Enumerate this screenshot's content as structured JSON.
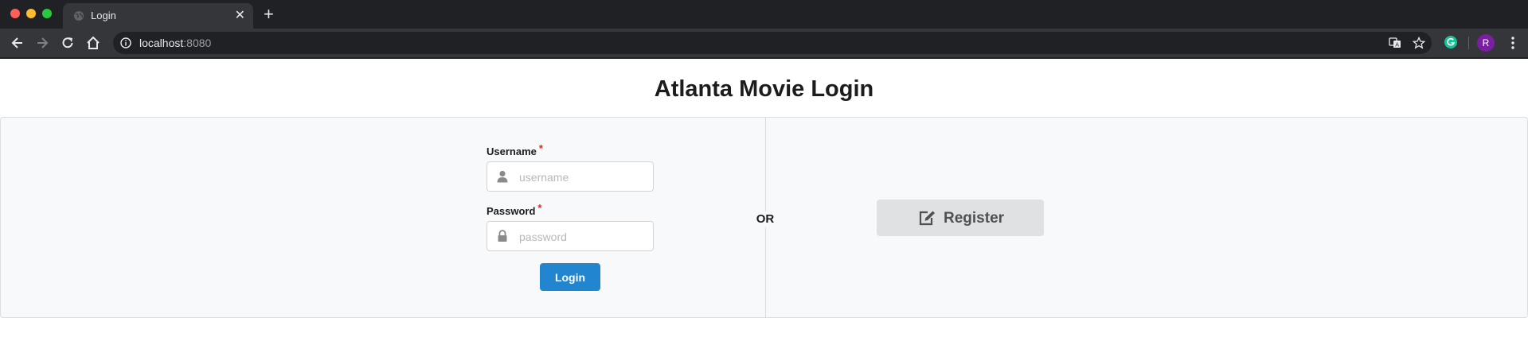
{
  "browser": {
    "tab": {
      "title": "Login",
      "favicon": "globe-icon",
      "close_icon": "close-icon"
    },
    "new_tab_icon": "plus-icon",
    "address": {
      "host": "localhost",
      "port": ":8080"
    },
    "avatar_initial": "R"
  },
  "page": {
    "title": "Atlanta Movie Login",
    "login_form": {
      "username": {
        "label": "Username",
        "required_mark": "*",
        "placeholder": "username",
        "value": "",
        "icon": "user-icon"
      },
      "password": {
        "label": "Password",
        "required_mark": "*",
        "placeholder": "password",
        "value": "",
        "icon": "lock-icon"
      },
      "submit_label": "Login"
    },
    "or_label": "OR",
    "register": {
      "label": "Register",
      "icon": "edit-icon"
    }
  },
  "colors": {
    "primary": "#2185d0",
    "required": "#db2828",
    "register_bg": "#e0e1e2",
    "avatar": "#7b1fa2"
  }
}
